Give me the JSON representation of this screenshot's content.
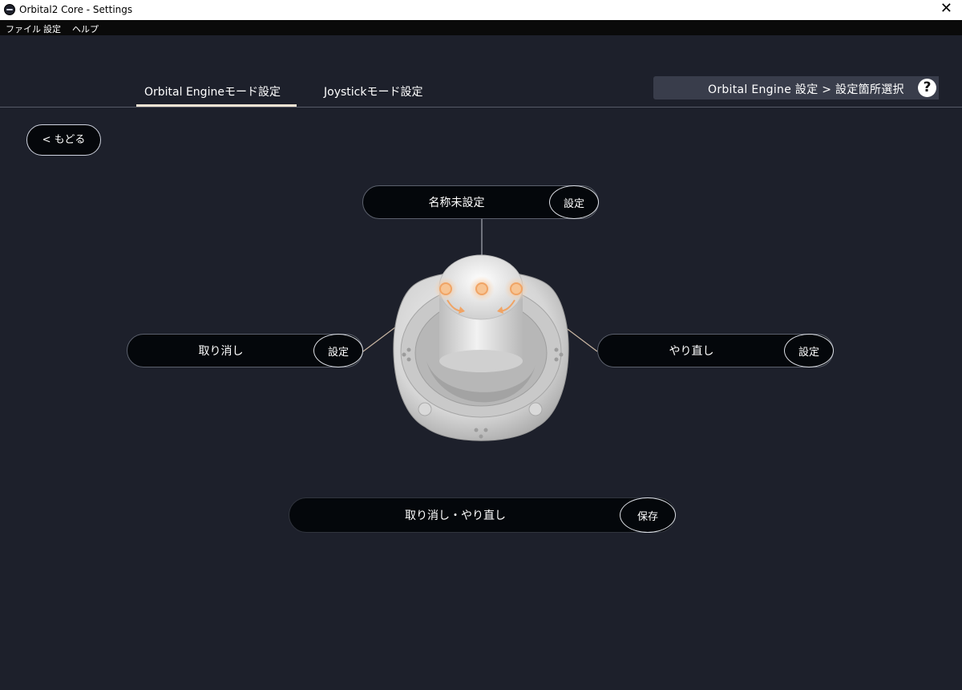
{
  "window": {
    "title": "Orbital2 Core - Settings",
    "close_label": "✕"
  },
  "menu": {
    "items": [
      "ファイル",
      "設定",
      "ヘルプ"
    ]
  },
  "tabs": [
    {
      "label": "Orbital Engineモード設定",
      "active": true
    },
    {
      "label": "Joystickモード設定",
      "active": false
    }
  ],
  "breadcrumb": {
    "text": "Orbital Engine 設定 > 設定箇所選択",
    "help_label": "?"
  },
  "back_button": {
    "label": "< もどる"
  },
  "controls": {
    "top": {
      "label": "名称未設定",
      "button": "設定"
    },
    "left": {
      "label": "取り消し",
      "button": "設定"
    },
    "right": {
      "label": "やり直し",
      "button": "設定"
    },
    "bottom": {
      "label": "取り消し・やり直し",
      "button": "保存"
    }
  },
  "colors": {
    "background": "#1d202b",
    "accent_underline": "#f1e3d3",
    "breadcrumb_bg": "#393d4b",
    "pill_bg": "#04070b",
    "highlight_glow": "#f3b781"
  },
  "icons": [
    "app-icon",
    "close-icon",
    "help-icon",
    "rotate-left-arrow-icon",
    "rotate-right-arrow-icon"
  ]
}
